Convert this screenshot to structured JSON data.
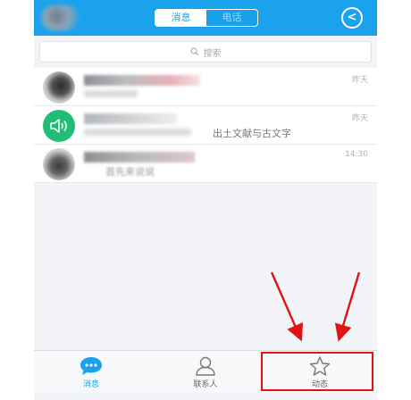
{
  "header": {
    "segments": [
      {
        "label": "消息",
        "active": true
      },
      {
        "label": "电话",
        "active": false
      }
    ],
    "back_icon": "chevron-left-icon"
  },
  "search": {
    "placeholder": "搜索",
    "icon": "search-icon"
  },
  "conversations": [
    {
      "time": "昨天",
      "message": ""
    },
    {
      "time": "昨天",
      "message": "出土文献与古文字"
    },
    {
      "time": "14:30",
      "message": "首先来说说"
    }
  ],
  "tabbar": {
    "tabs": [
      {
        "label": "消息",
        "icon": "chat-bubble-icon",
        "active": true
      },
      {
        "label": "联系人",
        "icon": "contacts-icon",
        "active": false
      },
      {
        "label": "动态",
        "icon": "star-icon",
        "active": false
      }
    ]
  },
  "colors": {
    "accent": "#1aa3ec",
    "annotation": "#e01414",
    "speaker_avatar": "#22bd74"
  }
}
